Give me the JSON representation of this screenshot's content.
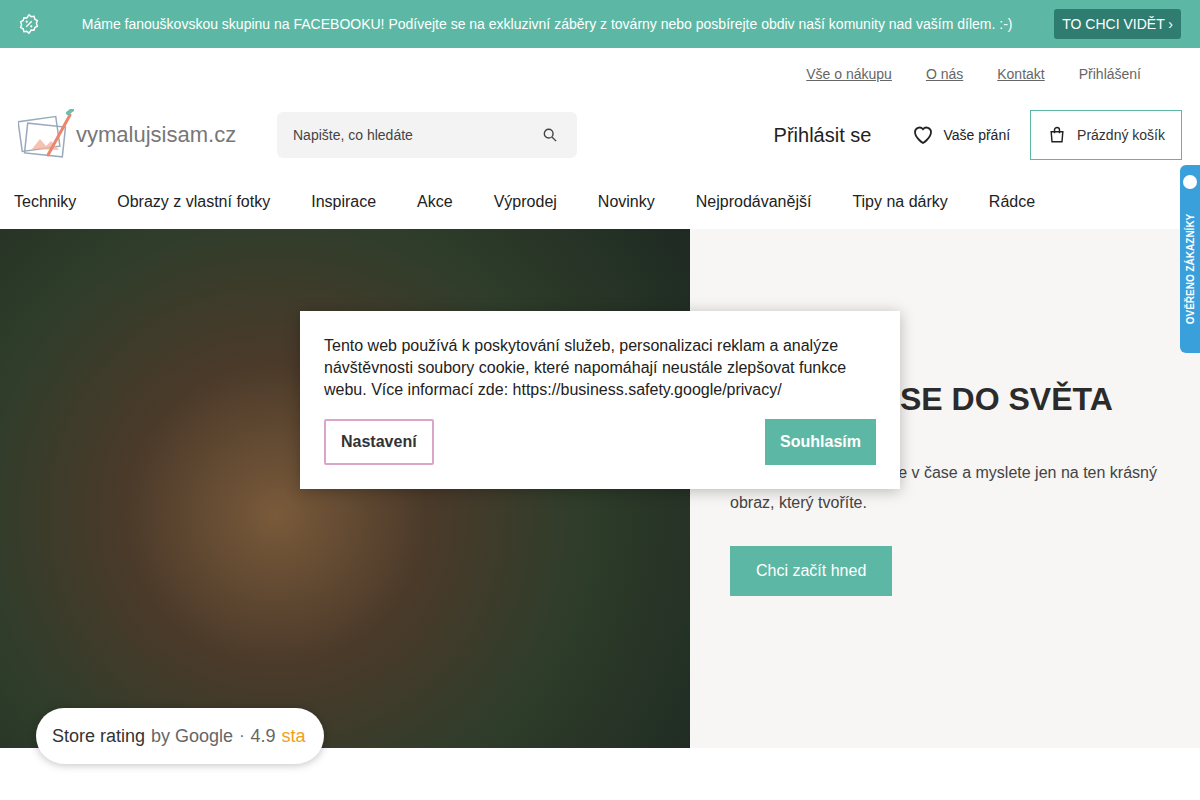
{
  "banner": {
    "text": "Máme fanouškovskou skupinu na FACEBOOKU! Podívejte se na exkluzivní záběry z továrny nebo posbírejte obdiv naší komunity nad vaším dílem. :-)",
    "button": "TO CHCI VIDĚT",
    "button_arrow": "›"
  },
  "top_links": [
    {
      "label": "Vše o nákupu",
      "underlined": true
    },
    {
      "label": "O nás",
      "underlined": true
    },
    {
      "label": "Kontakt",
      "underlined": true
    },
    {
      "label": "Přihlášení",
      "underlined": false
    }
  ],
  "logo": "vymalujsisam.cz",
  "search": {
    "placeholder": "Napište, co hledáte"
  },
  "login": "Přihlásit se",
  "wishlist": "Vaše přání",
  "cart": "Prázdný košík",
  "nav": [
    "Techniky",
    "Obrazy z vlastní fotky",
    "Inspirace",
    "Akce",
    "Výprodej",
    "Novinky",
    "Nejprodávanější",
    "Tipy na dárky",
    "Rádce"
  ],
  "badge": "OVĚŘENO ZÁKAZNÍKY",
  "hero": {
    "heading": "SE DO SVĚTA",
    "text": "Vypněte hlavu, ztraťte se v čase a myslete jen na ten krásný obraz, který tvoříte.",
    "button": "Chci začít hned"
  },
  "cookie": {
    "text": "Tento web používá k poskytování služeb, personalizaci reklam a analýze návštěvnosti soubory cookie, které napomáhají neustále zlepšovat funkce webu. Více informací zde: https://business.safety.google/privacy/",
    "buttons": [
      {
        "label": "Nastavení",
        "kind": "outline"
      },
      {
        "label": "Souhlasím",
        "kind": "primary"
      }
    ]
  },
  "rating": {
    "label": "Store rating",
    "source": "by Google",
    "separator": "·",
    "score": "4.9",
    "star_glyph": "sta"
  }
}
